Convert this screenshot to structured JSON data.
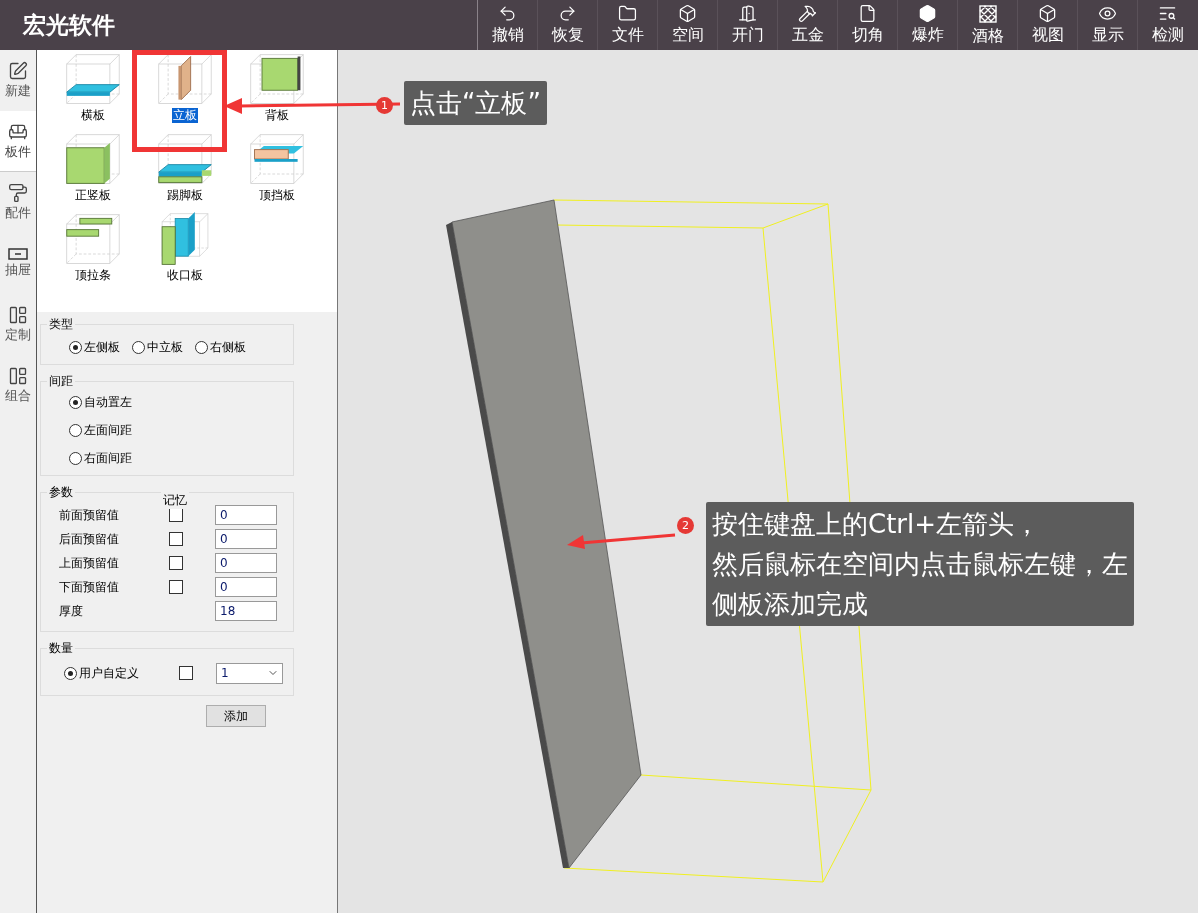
{
  "app": {
    "title": "宏光软件"
  },
  "toolbar": [
    {
      "label": "撤销"
    },
    {
      "label": "恢复"
    },
    {
      "label": "文件"
    },
    {
      "label": "空间"
    },
    {
      "label": "开门"
    },
    {
      "label": "五金"
    },
    {
      "label": "切角"
    },
    {
      "label": "爆炸"
    },
    {
      "label": "酒格"
    },
    {
      "label": "视图"
    },
    {
      "label": "显示"
    },
    {
      "label": "检测"
    }
  ],
  "sidebar": {
    "items": [
      {
        "label": "新建",
        "selected": false
      },
      {
        "label": "板件",
        "selected": true
      },
      {
        "label": "配件",
        "selected": false
      },
      {
        "label": "抽屉",
        "selected": false
      },
      {
        "label": "定制",
        "selected": false
      },
      {
        "label": "组合",
        "selected": false
      }
    ]
  },
  "parts": [
    {
      "label": "横板",
      "selected": false
    },
    {
      "label": "立板",
      "selected": true
    },
    {
      "label": "背板",
      "selected": false
    },
    {
      "label": "正竖板",
      "selected": false
    },
    {
      "label": "踢脚板",
      "selected": false
    },
    {
      "label": "顶挡板",
      "selected": false
    },
    {
      "label": "顶拉条",
      "selected": false
    },
    {
      "label": "收口板",
      "selected": false
    }
  ],
  "type_group": {
    "legend": "类型",
    "options": [
      {
        "label": "左侧板",
        "selected": true
      },
      {
        "label": "中立板",
        "selected": false
      },
      {
        "label": "右侧板",
        "selected": false
      }
    ]
  },
  "spacing_group": {
    "legend": "间距",
    "options": [
      {
        "label": "自动置左",
        "selected": true
      },
      {
        "label": "左面间距",
        "selected": false
      },
      {
        "label": "右面间距",
        "selected": false
      }
    ]
  },
  "params_group": {
    "legend": "参数",
    "memory_header": "记忆",
    "rows": [
      {
        "kind": "reserve",
        "label": "前面预留值",
        "checked": false,
        "value": "0"
      },
      {
        "kind": "reserve",
        "label": "后面预留值",
        "checked": false,
        "value": "0"
      },
      {
        "kind": "reserve",
        "label": "上面预留值",
        "checked": false,
        "value": "0"
      },
      {
        "kind": "reserve",
        "label": "下面预留值",
        "checked": false,
        "value": "0"
      },
      {
        "kind": "plain",
        "label": "厚度",
        "value": "18"
      }
    ]
  },
  "quantity_group": {
    "legend": "数量",
    "option": {
      "label": "用户自定义",
      "selected": true
    },
    "checked": false,
    "value": "1"
  },
  "add_button": "添加",
  "callouts": [
    {
      "number": "1",
      "text": "点击“立板”"
    },
    {
      "number": "2",
      "lines": [
        "按住键盘上的Ctrl+左箭头，",
        "然后鼠标在空间内点击鼠标左键，左",
        "侧板添加完成"
      ]
    }
  ]
}
